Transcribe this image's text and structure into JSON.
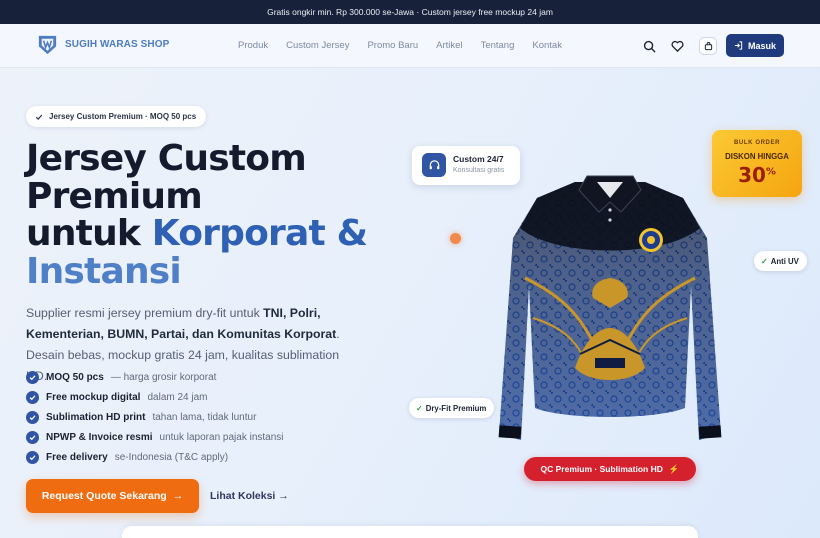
{
  "topbar": {
    "text": "Gratis ongkir min. Rp 300.000 se-Jawa · Custom jersey free mockup 24 jam"
  },
  "brand": {
    "name": "SUGIH WARAS SHOP"
  },
  "nav": {
    "items": [
      "Produk",
      "Custom Jersey",
      "Promo Baru",
      "Artikel",
      "Tentang",
      "Kontak"
    ],
    "login_label": "Masuk",
    "icons": [
      "search-icon",
      "heart-icon",
      "cart-icon",
      "login-icon"
    ]
  },
  "hero": {
    "badge": "Jersey Custom Premium · MOQ 50 pcs",
    "title_line1": "Jersey Custom",
    "title_line2": "Premium",
    "title_line3_a": "untuk ",
    "title_line3_b": "Korporat &",
    "title_line4": "Instansi",
    "desc_a": "Supplier resmi jersey premium dry-fit untuk ",
    "desc_b": "TNI, Polri, Kementerian, BUMN, Partai, dan Komunitas Korporat",
    "desc_c": ". Desain bebas, mockup gratis 24 jam, kualitas sublimation HD.",
    "features": [
      {
        "key": "MOQ 50 pcs",
        "value": " — harga grosir korporat"
      },
      {
        "key": "Free mockup digital",
        "value": "dalam 24 jam"
      },
      {
        "key": "Sublimation HD print",
        "value": "tahan lama, tidak luntur"
      },
      {
        "key": "NPWP & Invoice resmi",
        "value": "untuk laporan pajak instansi"
      },
      {
        "key": "Free delivery",
        "value": "se-Indonesia (T&C apply)"
      }
    ],
    "cta_label": "Request Quote Sekarang",
    "cta_arrow": "→",
    "secondary_link": "Lihat Koleksi →"
  },
  "floating": {
    "cs_title": "Custom 24/7",
    "cs_sub": "Konsultasi gratis",
    "bulk_label": "BULK ORDER",
    "bulk_discount": "DISKON HINGGA",
    "bulk_value": "30",
    "bulk_unit": "%",
    "anti_uv": "Anti UV",
    "dry_fit": "Dry-Fit Premium",
    "qc": "QC Premium · Sublimation HD",
    "qc_icon": "⚡"
  },
  "colors": {
    "primary": "#1f3b7d",
    "accent": "#2e60b3",
    "cta": "#ef6c11",
    "badge_gold": "#f5a50f",
    "qc_red": "#d5202d"
  }
}
